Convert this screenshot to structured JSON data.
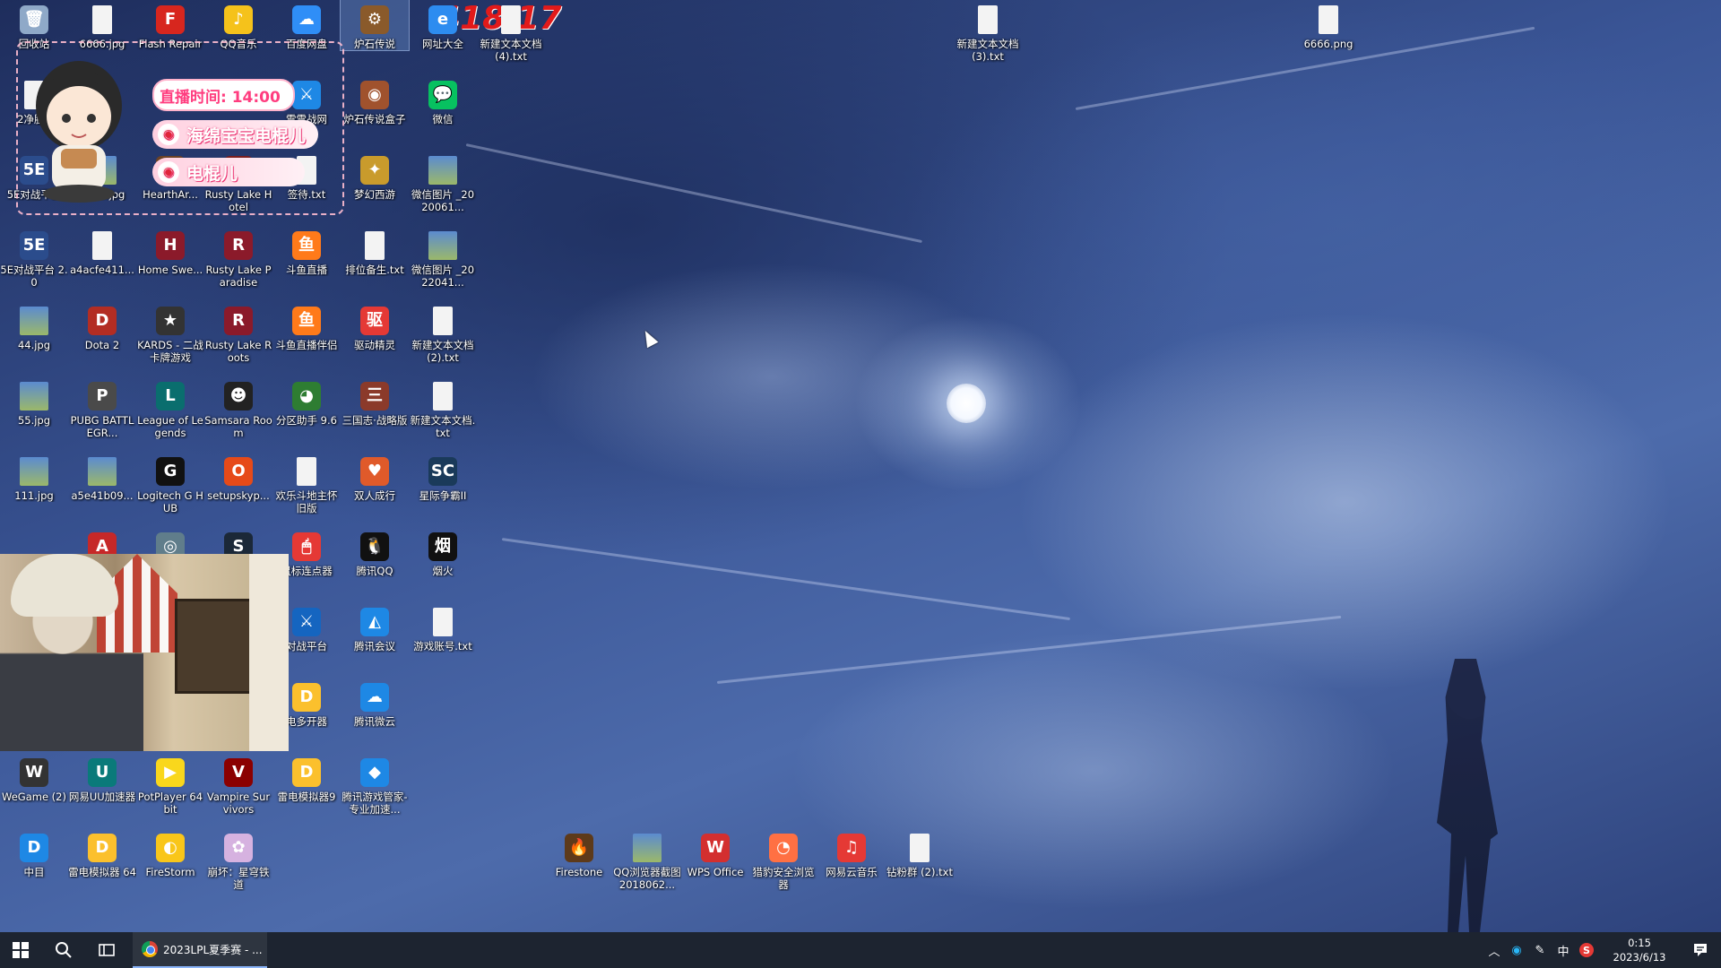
{
  "desktop": {
    "hud_number": "418/17",
    "icons": [
      {
        "label": "回收站",
        "glyph": "🗑",
        "bg": "#8fa9c8"
      },
      {
        "label": "6666.jpg",
        "glyph": "",
        "kind": "file"
      },
      {
        "label": "Flash Repair",
        "glyph": "F",
        "bg": "#d7261e"
      },
      {
        "label": "QQ音乐",
        "glyph": "♪",
        "bg": "#f5c21b"
      },
      {
        "label": "百度网盘",
        "glyph": "☁",
        "bg": "#2f8ef7"
      },
      {
        "label": "炉石传说",
        "glyph": "⚙",
        "bg": "#8a5a2b",
        "selected": true
      },
      {
        "label": "网址大全",
        "glyph": "e",
        "bg": "#2d8cf0"
      },
      {
        "label": "新建文本文档 (4).txt",
        "glyph": "",
        "kind": "file"
      },
      {
        "label": "新建文本文档 (3).txt",
        "glyph": "",
        "kind": "file"
      },
      {
        "label": "6666.png",
        "glyph": "",
        "kind": "file"
      },
      {
        "label": "2净胜S",
        "glyph": "",
        "kind": "file"
      },
      {
        "label": "雷雪战网",
        "glyph": "⚔",
        "bg": "#1e88e5"
      },
      {
        "label": "炉石传说盒子",
        "glyph": "◉",
        "bg": "#a0522d"
      },
      {
        "label": "微信",
        "glyph": "💬",
        "bg": "#07c160"
      },
      {
        "label": "5E对战平台",
        "glyph": "5E",
        "bg": "#2b4c8c"
      },
      {
        "label": "5555.jpg",
        "glyph": "",
        "kind": "img"
      },
      {
        "label": "HearthAr...",
        "glyph": "H",
        "bg": "#6b4226"
      },
      {
        "label": "Rusty Lake Hotel",
        "glyph": "R",
        "bg": "#7b1e1e"
      },
      {
        "label": "签待.txt",
        "glyph": "",
        "kind": "file"
      },
      {
        "label": "梦幻西游",
        "glyph": "✦",
        "bg": "#c99b2c"
      },
      {
        "label": "微信图片 _2020061...",
        "glyph": "",
        "kind": "img"
      },
      {
        "label": "5E对战平台 2.0",
        "glyph": "5E",
        "bg": "#2b4c8c"
      },
      {
        "label": "a4acfe411...",
        "glyph": "",
        "kind": "file"
      },
      {
        "label": "Home Swe...",
        "glyph": "H",
        "bg": "#8b1a2a"
      },
      {
        "label": "Rusty Lake Paradise",
        "glyph": "R",
        "bg": "#8b1a2a"
      },
      {
        "label": "斗鱼直播",
        "glyph": "鱼",
        "bg": "#ff7a1a"
      },
      {
        "label": "排位备生.txt",
        "glyph": "",
        "kind": "file"
      },
      {
        "label": "微信图片 _2022041...",
        "glyph": "",
        "kind": "img"
      },
      {
        "label": "44.jpg",
        "glyph": "",
        "kind": "img"
      },
      {
        "label": "Dota 2",
        "glyph": "D",
        "bg": "#b32d23"
      },
      {
        "label": "KARDS - 二战卡牌游戏",
        "glyph": "★",
        "bg": "#333333"
      },
      {
        "label": "Rusty Lake Roots",
        "glyph": "R",
        "bg": "#8b1a2a"
      },
      {
        "label": "斗鱼直播伴侣",
        "glyph": "鱼",
        "bg": "#ff7a1a"
      },
      {
        "label": "驱动精灵",
        "glyph": "驱",
        "bg": "#e53935"
      },
      {
        "label": "新建文本文档 (2).txt",
        "glyph": "",
        "kind": "file"
      },
      {
        "label": "55.jpg",
        "glyph": "",
        "kind": "img"
      },
      {
        "label": "PUBG BATTLEGR...",
        "glyph": "P",
        "bg": "#4a4a4a"
      },
      {
        "label": "League of Legends",
        "glyph": "L",
        "bg": "#0a6e6e"
      },
      {
        "label": "Samsara Room",
        "glyph": "☻",
        "bg": "#222222"
      },
      {
        "label": "分区助手 9.6",
        "glyph": "◕",
        "bg": "#2e7d32"
      },
      {
        "label": "三国志·战略版",
        "glyph": "三",
        "bg": "#8b3a2a"
      },
      {
        "label": "新建文本文档.txt",
        "glyph": "",
        "kind": "file"
      },
      {
        "label": "111.jpg",
        "glyph": "",
        "kind": "img"
      },
      {
        "label": "a5e41b09...",
        "glyph": "",
        "kind": "img"
      },
      {
        "label": "Logitech G HUB",
        "glyph": "G",
        "bg": "#111111"
      },
      {
        "label": "setupskyp...",
        "glyph": "O",
        "bg": "#e64a19"
      },
      {
        "label": "欢乐斗地主怀旧版",
        "glyph": "",
        "kind": "file"
      },
      {
        "label": "双人成行",
        "glyph": "♥",
        "bg": "#e05a2a"
      },
      {
        "label": "星际争霸II",
        "glyph": "SC",
        "bg": "#1a3a5a"
      },
      {
        "label": "",
        "glyph": "A",
        "bg": "#c62828"
      },
      {
        "label": "",
        "glyph": "◎",
        "bg": "#607d8b"
      },
      {
        "label": "",
        "glyph": "S",
        "bg": "#1b2838"
      },
      {
        "label": "鼠标连点器",
        "glyph": "🖱",
        "bg": "#e53935"
      },
      {
        "label": "腾讯QQ",
        "glyph": "🐧",
        "bg": "#111111"
      },
      {
        "label": "烟火",
        "glyph": "烟",
        "bg": "#111111"
      },
      {
        "label": "对战平台",
        "glyph": "⚔",
        "bg": "#1565c0"
      },
      {
        "label": "腾讯会议",
        "glyph": "◭",
        "bg": "#1e88e5"
      },
      {
        "label": "游戏账号.txt",
        "glyph": "",
        "kind": "file"
      },
      {
        "label": "电多开器",
        "glyph": "D",
        "bg": "#fbc02d"
      },
      {
        "label": "腾讯微云",
        "glyph": "☁",
        "bg": "#1e88e5"
      },
      {
        "label": "WeGame (2)",
        "glyph": "W",
        "bg": "#333333"
      },
      {
        "label": "网易UU加速器",
        "glyph": "U",
        "bg": "#0a7a7a"
      },
      {
        "label": "PotPlayer 64 bit",
        "glyph": "▶",
        "bg": "#f9d71c"
      },
      {
        "label": "Vampire Survivors",
        "glyph": "V",
        "bg": "#8b0000"
      },
      {
        "label": "雷电模拟器9",
        "glyph": "D",
        "bg": "#fbc02d"
      },
      {
        "label": "腾讯游戏管家-专业加速...",
        "glyph": "◆",
        "bg": "#1e88e5"
      },
      {
        "label": "中目",
        "glyph": "D",
        "bg": "#1e88e5"
      },
      {
        "label": "雷电模拟器 64",
        "glyph": "D",
        "bg": "#fbc02d"
      },
      {
        "label": "FireStorm",
        "glyph": "◐",
        "bg": "#f9c61a"
      },
      {
        "label": "崩坏：星穹铁道",
        "glyph": "✿",
        "bg": "#d6b2e0"
      },
      {
        "label": "Firestone",
        "glyph": "🔥",
        "bg": "#5d3a1a"
      },
      {
        "label": "QQ浏览器截图2018062...",
        "glyph": "",
        "kind": "img"
      },
      {
        "label": "WPS Office",
        "glyph": "W",
        "bg": "#d32f2f"
      },
      {
        "label": "猎豹安全浏览器",
        "glyph": "◔",
        "bg": "#ff7043"
      },
      {
        "label": "网易云音乐",
        "glyph": "♫",
        "bg": "#e53935"
      },
      {
        "label": "钻粉群 (2).txt",
        "glyph": "",
        "kind": "file"
      }
    ]
  },
  "overlay": {
    "time_label": "直播时间: 14:00",
    "name1": "海绵宝宝电棍儿",
    "name2": "电棍儿"
  },
  "taskbar": {
    "chrome_task_label": "2023LPL夏季赛 - ...",
    "tray_ime": "中",
    "tray_antivirus": "S",
    "clock_time": "0:15",
    "clock_date": "2023/6/13"
  }
}
